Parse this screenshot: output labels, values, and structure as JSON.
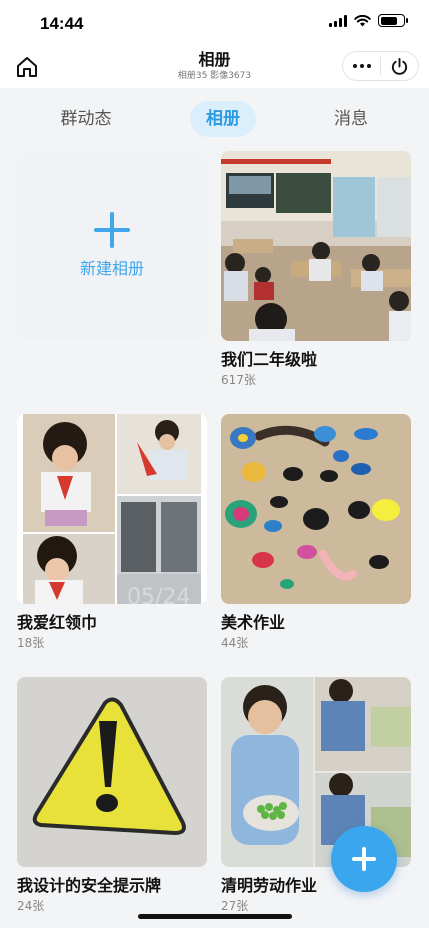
{
  "status_bar": {
    "time": "14:44",
    "battery_level": 0.75
  },
  "nav": {
    "title": "相册",
    "subtitle": "相册35 影像3673",
    "home_icon": "home-icon",
    "more_icon": "more-dots-icon",
    "power_icon": "power-icon"
  },
  "tabs": [
    {
      "label": "群动态",
      "active": false
    },
    {
      "label": "相册",
      "active": true
    },
    {
      "label": "消息",
      "active": false
    }
  ],
  "new_album": {
    "label": "新建相册",
    "icon": "plus-icon"
  },
  "albums": [
    {
      "title": "我们二年级啦",
      "count": "617张",
      "thumb": "classroom-photo"
    },
    {
      "title": "我爱红领巾",
      "count": "18张",
      "thumb": "red-scarf-collage",
      "overlay_text": "05/24"
    },
    {
      "title": "美术作业",
      "count": "44张",
      "thumb": "insect-crafts-photo"
    },
    {
      "title": "我设计的安全提示牌",
      "count": "24张",
      "thumb": "warning-sign-drawing"
    },
    {
      "title": "清明劳动作业",
      "count": "27张",
      "thumb": "child-with-beans-collage"
    }
  ],
  "fab": {
    "icon": "plus-icon"
  },
  "colors": {
    "accent": "#3aa6ee",
    "tab_active_bg": "#dbeefb",
    "background": "#f3f4f6"
  }
}
